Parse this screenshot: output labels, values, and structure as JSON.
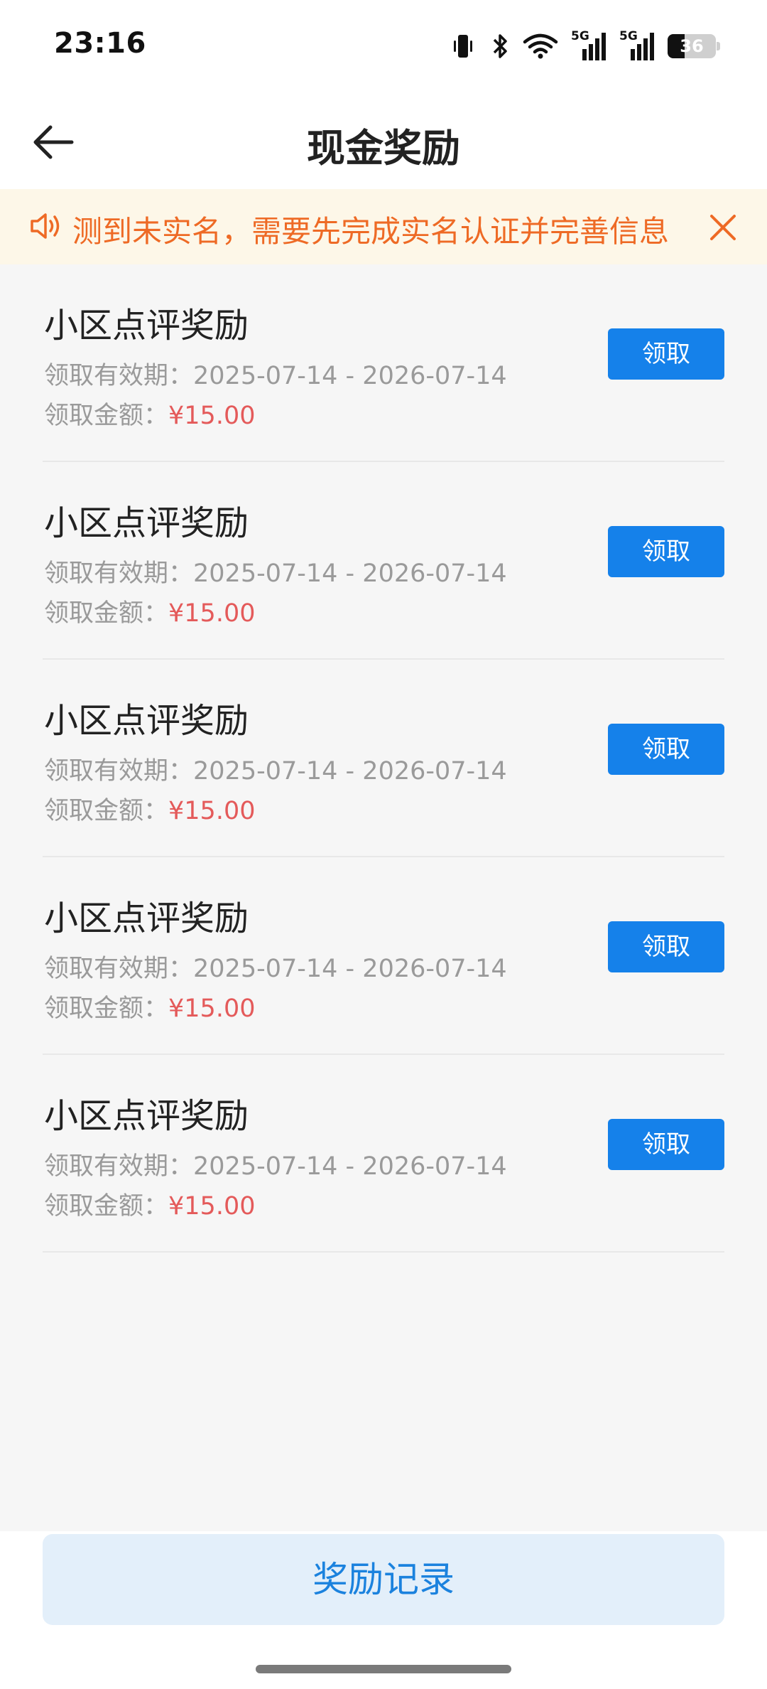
{
  "status_bar": {
    "time": "23:16",
    "signal_1_label": "5G",
    "signal_2_label": "5G",
    "battery_level": "36"
  },
  "header": {
    "title": "现金奖励"
  },
  "notice": {
    "text": "测到未实名，需要先完成实名认证并完善信息"
  },
  "rewards": [
    {
      "title": "小区点评奖励",
      "period_label": "领取有效期：",
      "period": "2025-07-14 - 2026-07-14",
      "amount_label": "领取金额：",
      "amount": "¥15.00",
      "button_label": "领取"
    },
    {
      "title": "小区点评奖励",
      "period_label": "领取有效期：",
      "period": "2025-07-14 - 2026-07-14",
      "amount_label": "领取金额：",
      "amount": "¥15.00",
      "button_label": "领取"
    },
    {
      "title": "小区点评奖励",
      "period_label": "领取有效期：",
      "period": "2025-07-14 - 2026-07-14",
      "amount_label": "领取金额：",
      "amount": "¥15.00",
      "button_label": "领取"
    },
    {
      "title": "小区点评奖励",
      "period_label": "领取有效期：",
      "period": "2025-07-14 - 2026-07-14",
      "amount_label": "领取金额：",
      "amount": "¥15.00",
      "button_label": "领取"
    },
    {
      "title": "小区点评奖励",
      "period_label": "领取有效期：",
      "period": "2025-07-14 - 2026-07-14",
      "amount_label": "领取金额：",
      "amount": "¥15.00",
      "button_label": "领取"
    }
  ],
  "footer": {
    "records_label": "奖励记录"
  },
  "colors": {
    "primary": "#1581ea",
    "notice_text": "#ee6a25",
    "notice_bg": "#fdf7e8",
    "amount": "#e45a5a"
  }
}
